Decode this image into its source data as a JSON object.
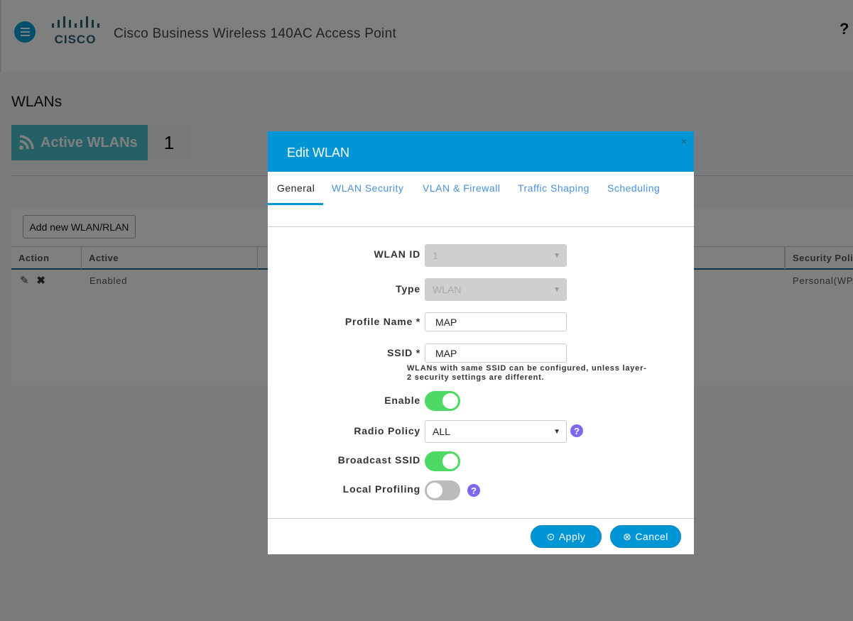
{
  "header": {
    "title": "Cisco Business Wireless 140AC Access Point",
    "logo_text": "cisco",
    "help": "?"
  },
  "page": {
    "title": "WLANs",
    "active_label": "Active WLANs",
    "active_count": "1"
  },
  "table": {
    "add_button": "Add new WLAN/RLAN",
    "columns": [
      "Action",
      "Active",
      "Security Policy"
    ],
    "rows": [
      {
        "active": "Enabled",
        "security": "Personal(WPA"
      }
    ]
  },
  "modal": {
    "title": "Edit WLAN",
    "close": "×",
    "tabs": [
      "General",
      "WLAN Security",
      "VLAN & Firewall",
      "Traffic Shaping",
      "Scheduling"
    ],
    "active_tab": "General",
    "fields": {
      "wlan_id": {
        "label": "WLAN ID",
        "value": "1"
      },
      "type": {
        "label": "Type",
        "value": "WLAN"
      },
      "profile_name": {
        "label": "Profile Name *",
        "value": "MAP"
      },
      "ssid": {
        "label": "SSID *",
        "value": "MAP",
        "hint": "WLANs with same SSID can be configured, unless layer-2 security settings are different."
      },
      "enable": {
        "label": "Enable",
        "on": true
      },
      "radio_policy": {
        "label": "Radio Policy",
        "value": "ALL"
      },
      "broadcast_ssid": {
        "label": "Broadcast SSID",
        "on": true
      },
      "local_profiling": {
        "label": "Local Profiling",
        "on": false
      }
    },
    "apply": "Apply",
    "cancel": "Cancel"
  },
  "colors": {
    "accent": "#0096d6",
    "toggle_on": "#4cd964",
    "help_icon": "#7b68ee",
    "active_box": "#4ac0cf"
  }
}
